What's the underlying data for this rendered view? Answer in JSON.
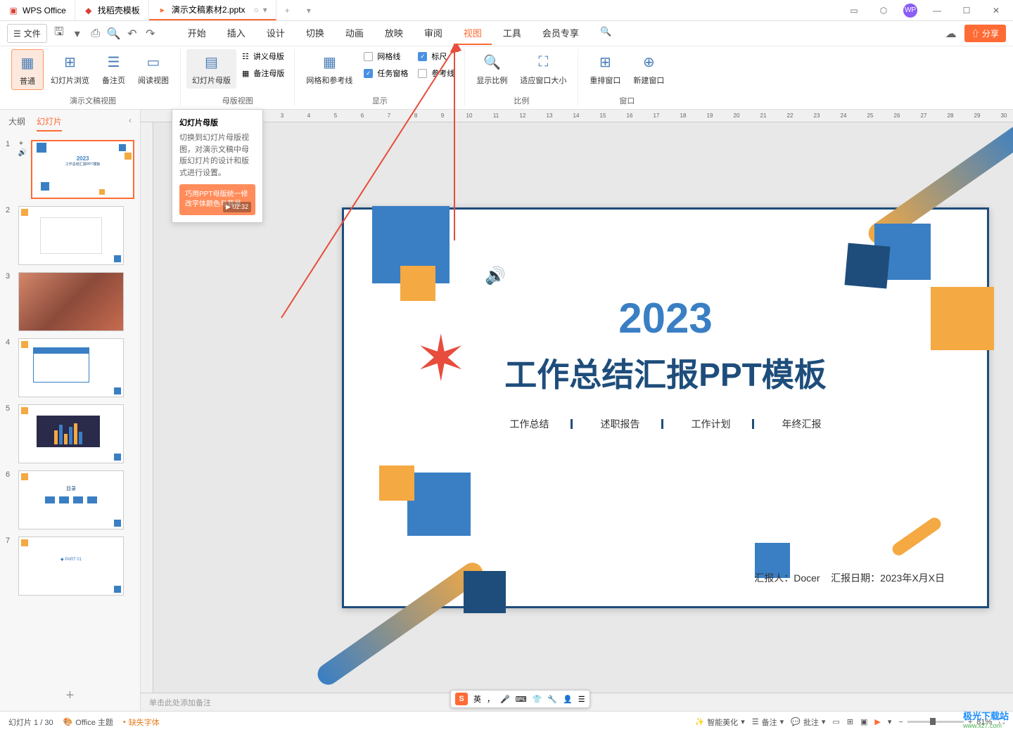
{
  "titlebar": {
    "app_name": "WPS Office",
    "tabs": [
      {
        "icon": "doc",
        "label": "找稻壳模板"
      },
      {
        "icon": "ppt",
        "label": "演示文稿素材2.pptx"
      }
    ]
  },
  "menubar": {
    "file": "文件",
    "tabs": [
      "开始",
      "插入",
      "设计",
      "切换",
      "动画",
      "放映",
      "审阅",
      "视图",
      "工具",
      "会员专享"
    ],
    "active_tab": "视图",
    "share": "分享"
  },
  "ribbon": {
    "g1_label": "演示文稿视图",
    "g1_items": [
      "普通",
      "幻灯片浏览",
      "备注页",
      "阅读视图"
    ],
    "g2_label": "母版视图",
    "g2_main": "幻灯片母版",
    "g2_items": [
      "讲义母版",
      "备注母版"
    ],
    "g3_label": "显示",
    "g3_main": "网格和参考线",
    "g3_checks": [
      {
        "label": "网格线",
        "checked": false
      },
      {
        "label": "任务窗格",
        "checked": true
      },
      {
        "label": "标尺",
        "checked": true
      },
      {
        "label": "参考线",
        "checked": false
      }
    ],
    "g4_label": "比例",
    "g4_items": [
      "显示比例",
      "适应窗口大小"
    ],
    "g5_label": "窗口",
    "g5_items": [
      "重排窗口",
      "新建窗口"
    ]
  },
  "tooltip": {
    "title": "幻灯片母版",
    "desc": "切换到幻灯片母版视图，对演示文稿中母版幻灯片的设计和版式进行设置。",
    "video": "巧用PPT母版统一修改字体颜色与背景",
    "time": "02:32"
  },
  "left_panel": {
    "tab_outline": "大纲",
    "tab_slides": "幻灯片",
    "slide_count": 7
  },
  "slide": {
    "year": "2023",
    "title": "工作总结汇报PPT模板",
    "subtitles": [
      "工作总结",
      "述职报告",
      "工作计划",
      "年终汇报"
    ],
    "reporter_label": "汇报人：",
    "reporter": "Docer",
    "date_label": "汇报日期：",
    "date": "2023年X月X日"
  },
  "notes": {
    "placeholder": "单击此处添加备注"
  },
  "statusbar": {
    "slide_info": "幻灯片 1 / 30",
    "theme": "Office 主题",
    "missing_font": "缺失字体",
    "beautify": "智能美化",
    "notes": "备注",
    "comments": "批注",
    "zoom": "81%"
  },
  "ime": {
    "lang": "英",
    "sogou": "S"
  },
  "watermark": {
    "name": "极光下载站",
    "url": "www.xz7.com"
  }
}
